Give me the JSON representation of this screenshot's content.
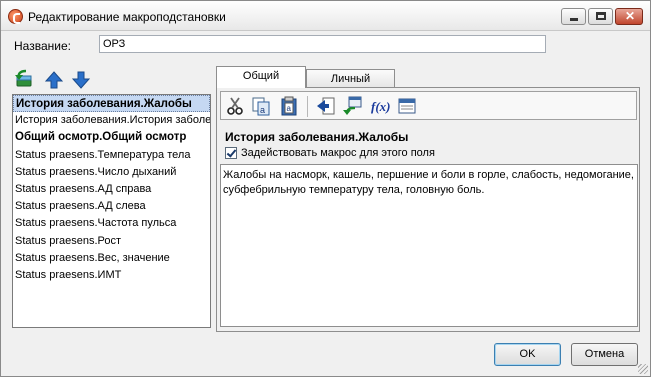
{
  "window": {
    "title": "Редактирование макроподстановки"
  },
  "name_field": {
    "label": "Название:",
    "value": "ОРЗ"
  },
  "macro_list": {
    "items": [
      {
        "label": "История заболевания.Жалобы",
        "bold": true,
        "selected": true
      },
      {
        "label": "История заболевания.История заболев...",
        "bold": false
      },
      {
        "label": "Общий осмотр.Общий осмотр",
        "bold": true
      },
      {
        "label": "Status praesens.Температура тела",
        "bold": false
      },
      {
        "label": "Status praesens.Число дыханий",
        "bold": false
      },
      {
        "label": "Status praesens.АД справа",
        "bold": false
      },
      {
        "label": "Status praesens.АД слева",
        "bold": false
      },
      {
        "label": "Status praesens.Частота пульса",
        "bold": false
      },
      {
        "label": "Status praesens.Рост",
        "bold": false
      },
      {
        "label": "Status praesens.Вес, значение",
        "bold": false
      },
      {
        "label": "Status praesens.ИМТ",
        "bold": false
      }
    ]
  },
  "tabs": [
    {
      "label": "Общий",
      "active": true
    },
    {
      "label": "Личный",
      "active": false
    }
  ],
  "editor": {
    "macro_title": "История заболевания.Жалобы",
    "checkbox_label": "Задействовать макрос для этого поля",
    "checkbox_checked": true,
    "text": "Жалобы на насморк, кашель, першение и боли в горле, слабость, недомогание,\nсубфебрильную температуру тела, головную боль."
  },
  "buttons": {
    "ok": "OK",
    "cancel": "Отмена"
  },
  "colors": {
    "selection": "#c5d8f2",
    "accent_blue": "#2a6fc9"
  }
}
